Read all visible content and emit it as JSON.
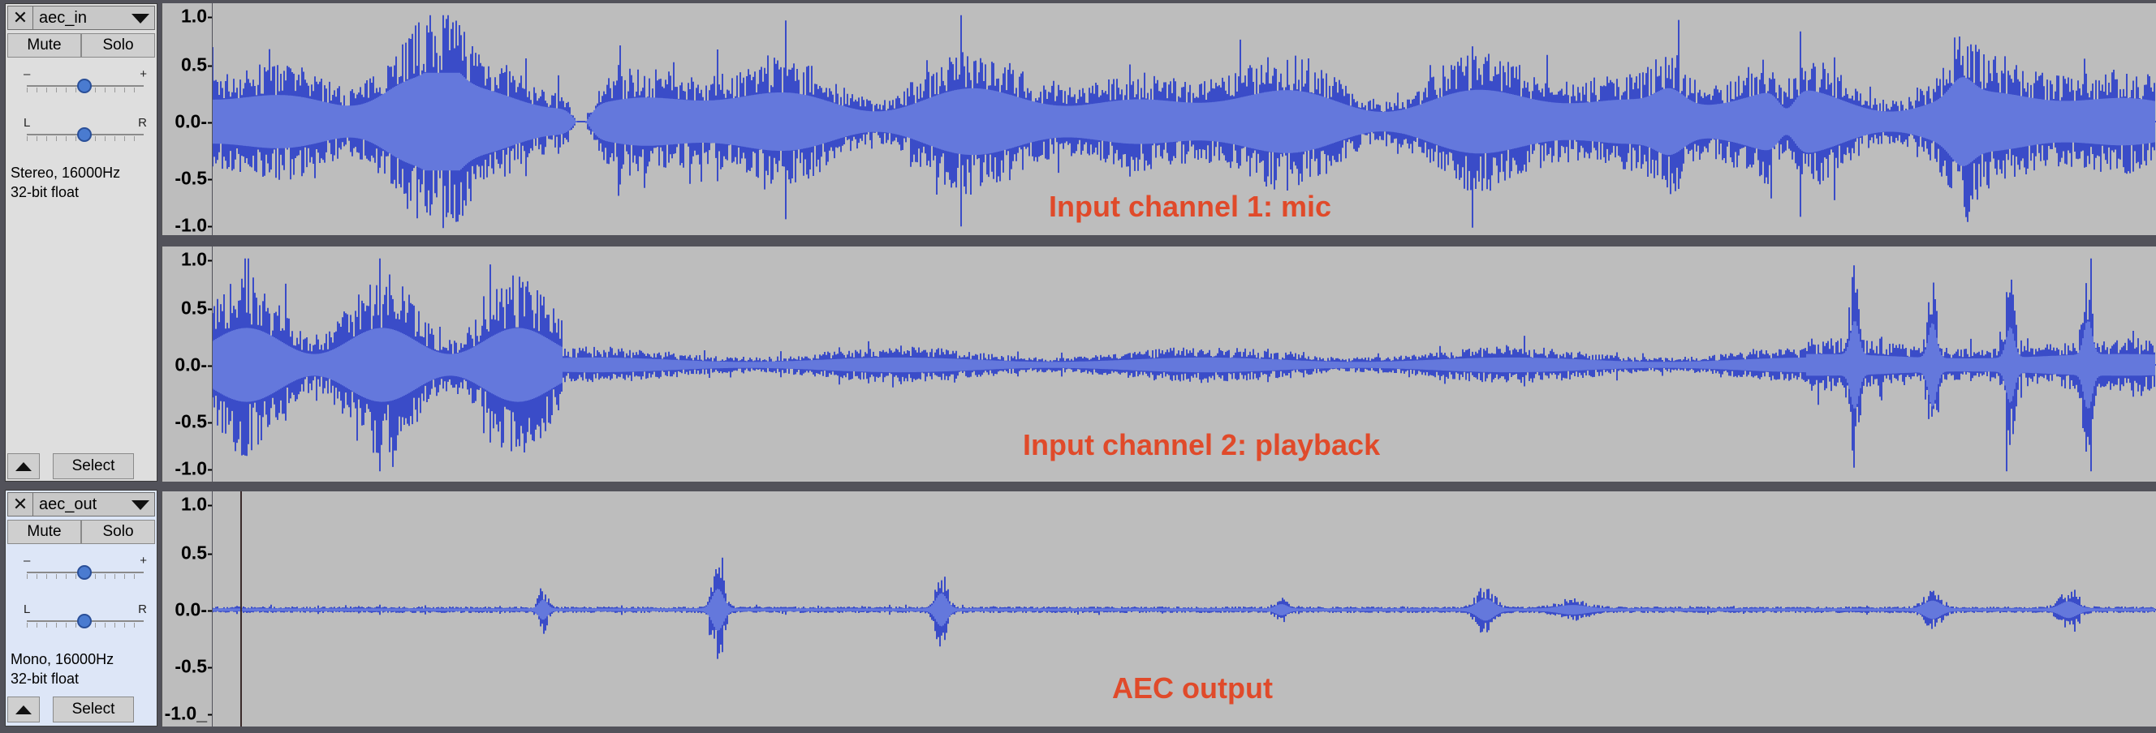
{
  "tracks": [
    {
      "name": "aec_in",
      "mute_label": "Mute",
      "solo_label": "Solo",
      "gain_minus": "–",
      "gain_plus": "+",
      "pan_left": "L",
      "pan_right": "R",
      "info_line1": "Stereo, 16000Hz",
      "info_line2": "32-bit float",
      "select_label": "Select",
      "channel_labels": [
        "Input channel 1: mic",
        "Input channel 2: playback"
      ],
      "scale_ticks": [
        "1.0",
        "0.5",
        "0.0-",
        "-0.5",
        "-1.0"
      ]
    },
    {
      "name": "aec_out",
      "mute_label": "Mute",
      "solo_label": "Solo",
      "gain_minus": "–",
      "gain_plus": "+",
      "pan_left": "L",
      "pan_right": "R",
      "info_line1": "Mono, 16000Hz",
      "info_line2": "32-bit float",
      "select_label": "Select",
      "channel_labels": [
        "AEC output"
      ],
      "scale_ticks": [
        "1.0",
        "0.5",
        "0.0-",
        "-0.5",
        "-1.0_"
      ]
    }
  ],
  "colors": {
    "waveform": "#3a4cc8",
    "waveform_rms": "#6478dc",
    "label": "#e04a2a",
    "background": "#bdbdbd"
  },
  "icons": [
    "close-icon",
    "track-menu-icon",
    "collapse-icon"
  ]
}
